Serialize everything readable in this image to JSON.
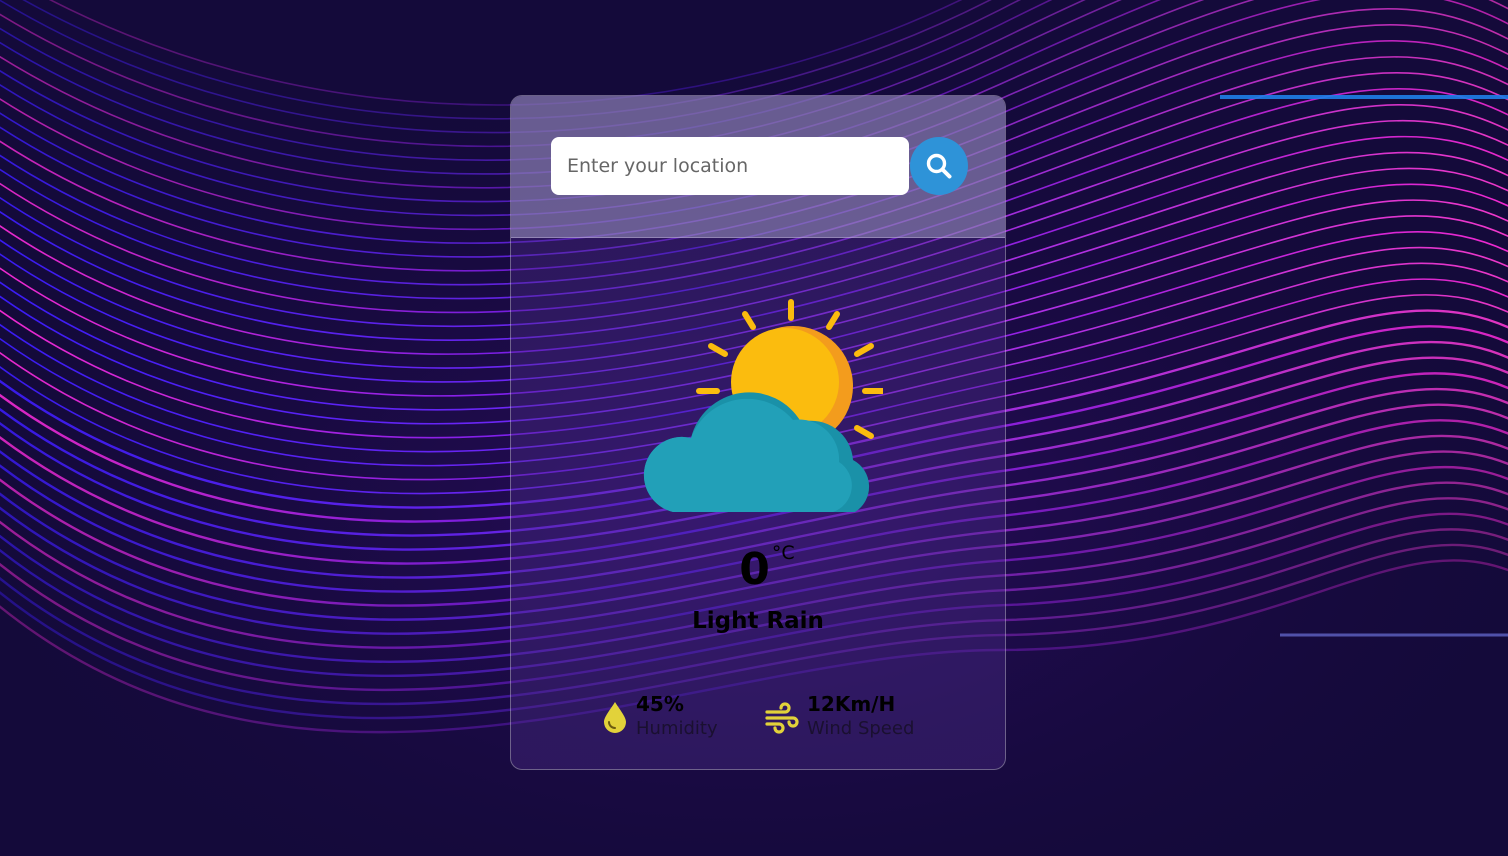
{
  "search": {
    "placeholder": "Enter your location",
    "value": "",
    "button_icon": "search-icon"
  },
  "weather": {
    "icon": "partly-cloudy-icon",
    "temperature": "0",
    "unit": "°C",
    "description": "Light Rain"
  },
  "details": {
    "humidity": {
      "icon": "water-drop-icon",
      "value": "45%",
      "label": "Humidity"
    },
    "wind": {
      "icon": "wind-icon",
      "value": "12Km/H",
      "label": "Wind Speed"
    }
  },
  "colors": {
    "accent": "#2e93d8",
    "sun": "#fbbc0e",
    "cloud": "#22a0b8",
    "detail_icon": "#e2d23a",
    "background": "#110834"
  }
}
